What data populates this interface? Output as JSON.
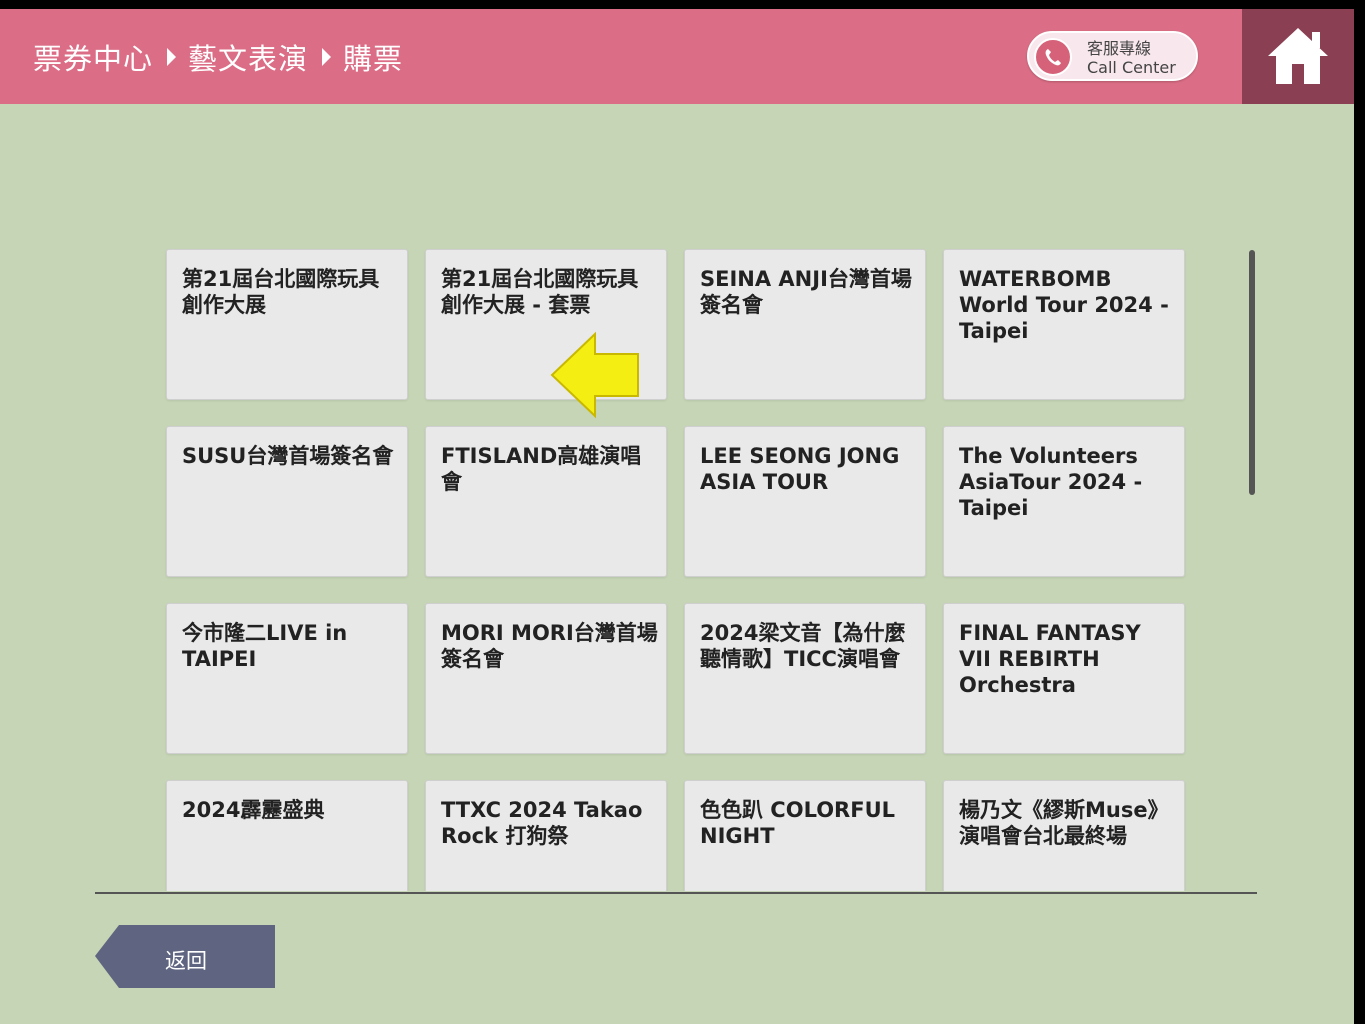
{
  "header": {
    "breadcrumb": [
      "票券中心",
      "藝文表演",
      "購票"
    ],
    "call_center": {
      "line1": "客服專線",
      "line2": "Call Center"
    },
    "home_icon": "home-icon",
    "color": "#db6e86",
    "home_bg": "#8a3f53"
  },
  "events": [
    "第21屆台北國際玩具創作大展",
    "第21屆台北國際玩具創作大展 - 套票",
    "SEINA ANJI台灣首場簽名會",
    "WATERBOMB World Tour 2024 - Taipei",
    "SUSU台灣首場簽名會",
    "FTISLAND高雄演唱會",
    "LEE SEONG JONG ASIA TOUR",
    "The Volunteers AsiaTour 2024 - Taipei",
    "今市隆二LIVE in TAIPEI",
    "MORI MORI台灣首場簽名會",
    "2024梁文音【為什麼聽情歌】TICC演唱會",
    "FINAL FANTASY VII REBIRTH Orchestra",
    "2024霹靂盛典",
    "TTXC 2024 Takao Rock 打狗祭",
    "色色趴 COLORFUL NIGHT",
    "楊乃文《繆斯Muse》演唱會台北最終場"
  ],
  "footer": {
    "back_label": "返回"
  },
  "background": "#c5d5b5"
}
